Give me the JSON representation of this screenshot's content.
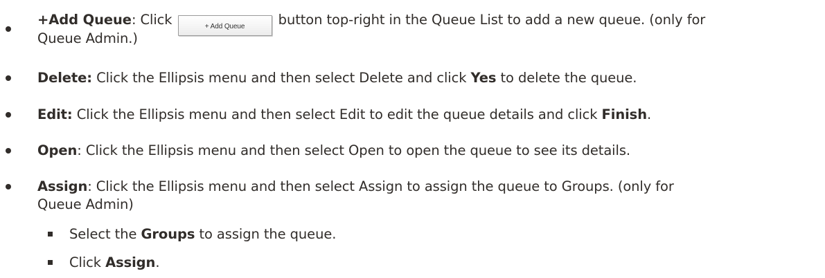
{
  "items": [
    {
      "title": "+Add Queue",
      "text_before_button": ": Click ",
      "button_label": "+ Add Queue",
      "text_after_button": " button top-right in the Queue List to add a new queue. (only for",
      "text_line2": "Queue Admin.)"
    },
    {
      "title": "Delete:",
      "text": " Click the Ellipsis menu and then select Delete and click ",
      "emphasis": "Yes",
      "text_end": " to delete the queue."
    },
    {
      "title": "Edit:",
      "text": " Click the Ellipsis menu and then select Edit to edit the queue details and click ",
      "emphasis": "Finish",
      "text_end": "."
    },
    {
      "title": "Open",
      "text": ": Click the Ellipsis menu and then select Open to open the queue to see its details."
    },
    {
      "title": "Assign",
      "text": ": Click the Ellipsis menu and then select Assign to assign the queue to Groups. (only for",
      "text_line2": "Queue Admin)"
    }
  ],
  "subitems": [
    {
      "text": "Select the ",
      "emphasis": "Groups",
      "text_end": " to assign the queue."
    },
    {
      "text": "Click ",
      "emphasis": "Assign",
      "text_end": "."
    }
  ]
}
